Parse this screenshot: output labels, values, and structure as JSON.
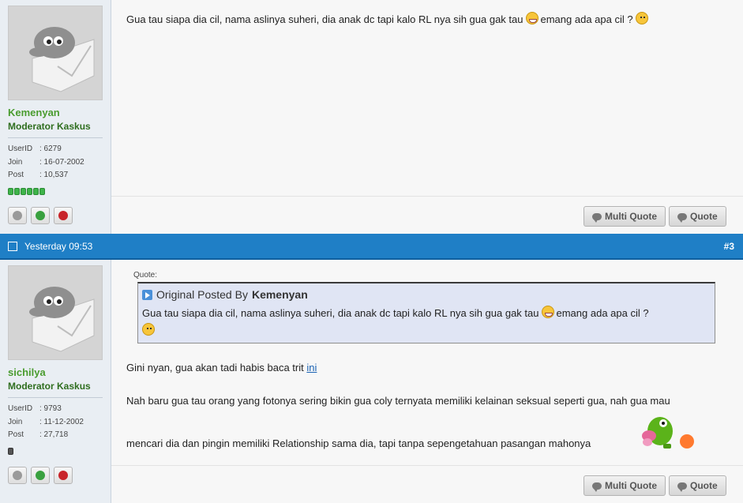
{
  "post1": {
    "username": "Kemenyan",
    "rank": "Moderator Kaskus",
    "stats": [
      {
        "label": "UserID",
        "value": ": 6279"
      },
      {
        "label": "Join",
        "value": ": 16-07-2002"
      },
      {
        "label": "Post",
        "value": ": 10,537"
      }
    ],
    "message_before": "Gua tau siapa dia cil, nama aslinya suheri, dia anak dc tapi kalo RL nya sih gua gak tau",
    "message_after": "emang ada apa cil ?",
    "multi_quote_label": "Multi Quote",
    "quote_label": "Quote"
  },
  "post_bar": {
    "timestamp": "Yesterday 09:53",
    "post_number": "#3"
  },
  "post2": {
    "username": "sichilya",
    "rank": "Moderator Kaskus",
    "stats": [
      {
        "label": "UserID",
        "value": ": 9793"
      },
      {
        "label": "Join",
        "value": ": 11-12-2002"
      },
      {
        "label": "Post",
        "value": ": 27,718"
      }
    ],
    "quote": {
      "label": "Quote:",
      "posted_by_prefix": "Original Posted By",
      "author": "Kemenyan",
      "text_before": "Gua tau siapa dia cil, nama aslinya suheri, dia anak dc tapi kalo RL nya sih gua gak tau",
      "text_after": "emang ada apa cil ?"
    },
    "line1_text": "Gini nyan, gua akan tadi habis baca trit",
    "line1_link": "ini",
    "line2_text": "Nah baru gua tau orang yang fotonya sering bikin gua coly ternyata memiliki kelainan seksual seperti gua, nah gua mau",
    "line3_text": "mencari dia dan pingin memiliki Relationship sama dia, tapi tanpa sepengetahuan pasangan mahonya",
    "multi_quote_label": "Multi Quote",
    "quote_label": "Quote"
  },
  "colors": {
    "bar_blue": "#1f7fc6",
    "username_green": "#4a9c2f",
    "rank_green": "#2f6e1f",
    "sidebar_bg": "#e9eef3",
    "quote_bg": "#e0e5f4"
  },
  "icons": [
    "ghost-avatar-icon",
    "reputation-bar",
    "offline-icon",
    "add-reputation-icon",
    "report-icon",
    "quote-bubble-icon",
    "check-icon",
    "quote-arrow-icon",
    "grin-emoticon",
    "blank-emoticon",
    "frog-emoticon"
  ]
}
